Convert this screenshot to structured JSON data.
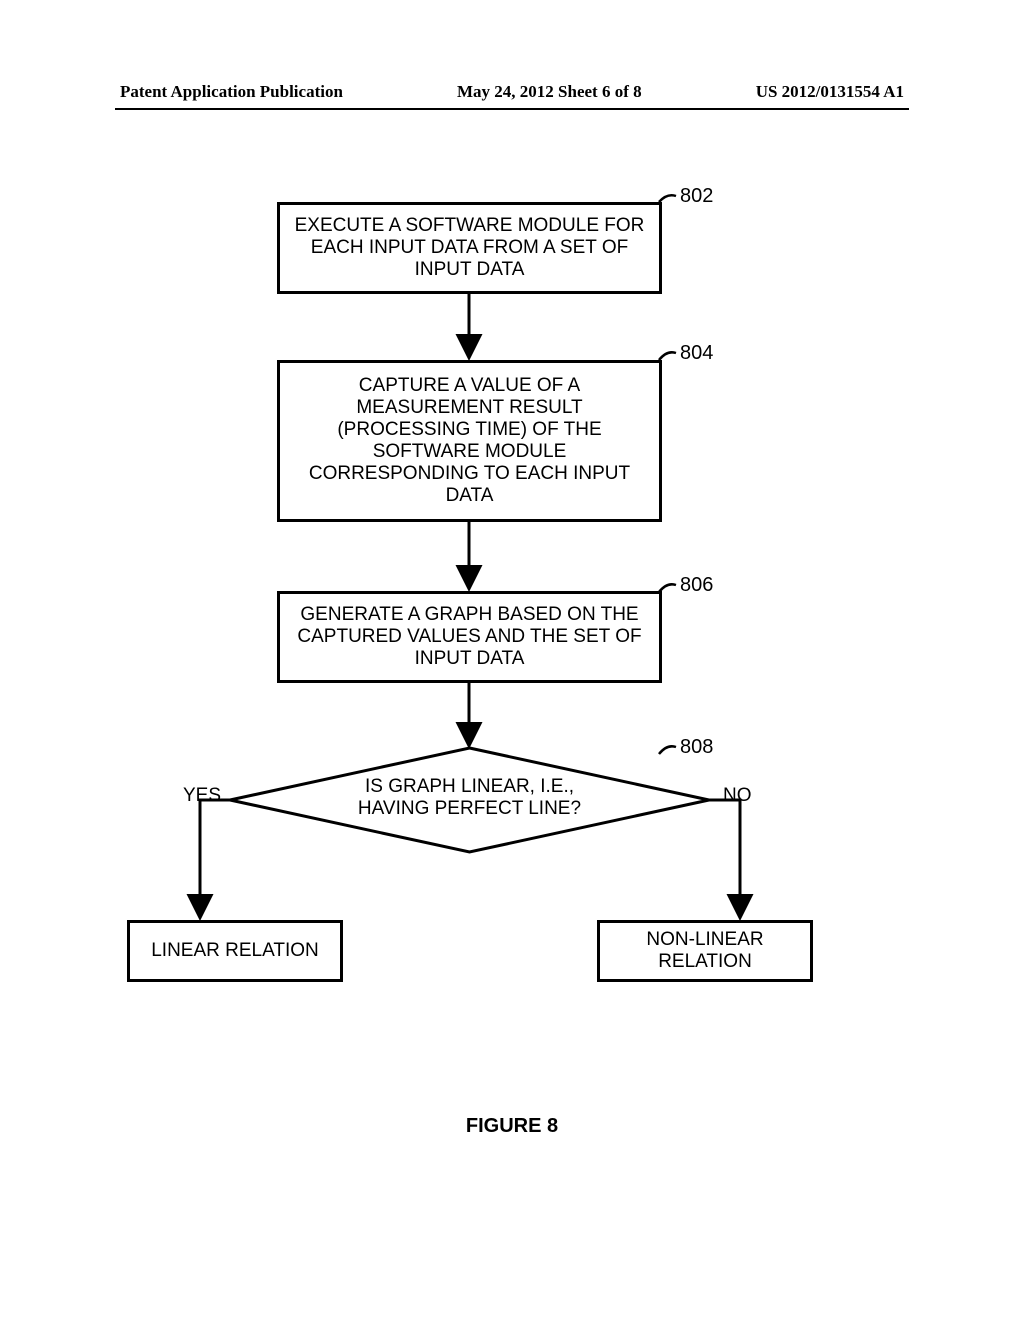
{
  "header": {
    "left": "Patent Application Publication",
    "center": "May 24, 2012  Sheet 6 of 8",
    "right": "US 2012/0131554 A1"
  },
  "flowchart": {
    "box1": {
      "text": "EXECUTE A SOFTWARE MODULE FOR EACH INPUT DATA FROM A SET OF INPUT DATA",
      "ref": "802"
    },
    "box2": {
      "text": "CAPTURE A VALUE OF A MEASUREMENT RESULT (PROCESSING TIME) OF THE SOFTWARE MODULE CORRESPONDING TO EACH INPUT DATA",
      "ref": "804"
    },
    "box3": {
      "text": "GENERATE A GRAPH BASED ON THE CAPTURED VALUES AND THE SET OF INPUT DATA",
      "ref": "806"
    },
    "decision": {
      "line1": "IS GRAPH LINEAR, I.E.,",
      "line2": "HAVING PERFECT LINE?",
      "ref": "808",
      "yes": "YES",
      "no": "NO"
    },
    "result_yes": "LINEAR RELATION",
    "result_no": "NON-LINEAR RELATION"
  },
  "caption": "FIGURE 8"
}
